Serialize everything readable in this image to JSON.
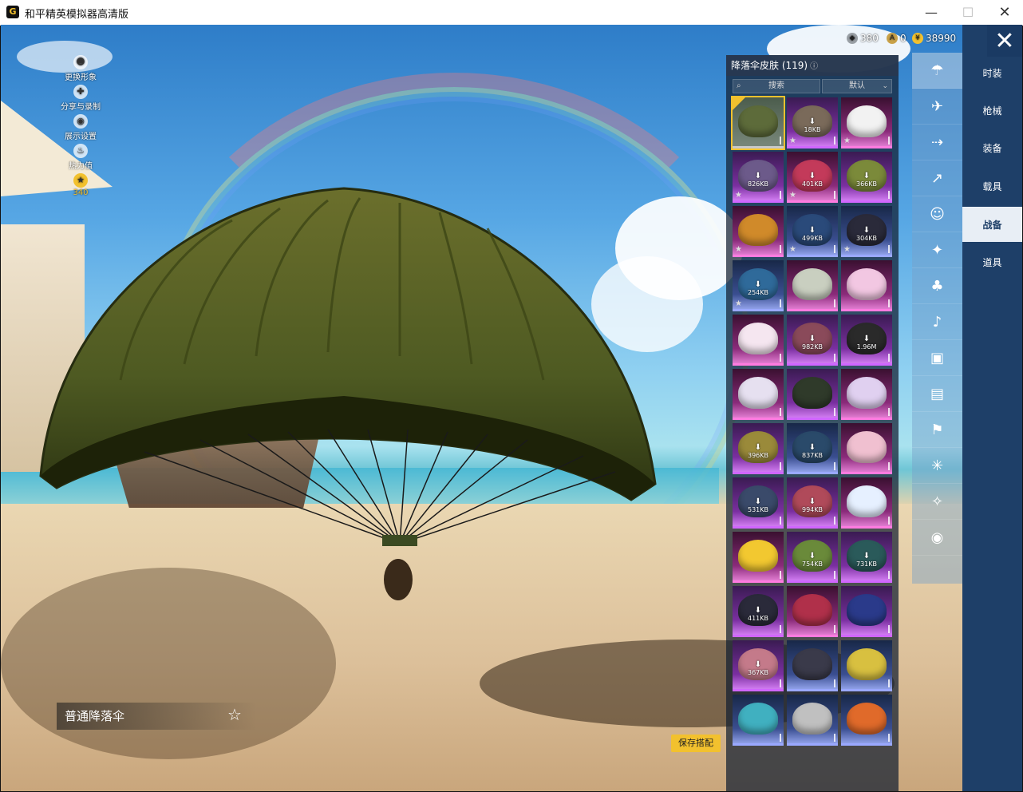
{
  "window": {
    "title": "和平精英模拟器高清版",
    "minimize": "—",
    "maximize": "☐",
    "close": "✕"
  },
  "currency": [
    {
      "icon": "gem-coin-icon",
      "value": "380",
      "color": "#9aa0a6"
    },
    {
      "icon": "badge-coin-icon",
      "value": "0",
      "color": "#c9a24a"
    },
    {
      "icon": "gold-coin-icon",
      "value": "38990",
      "color": "#f2c12e"
    }
  ],
  "left_menu": [
    {
      "icon": "avatar-icon",
      "label": "更换形象"
    },
    {
      "icon": "share-icon",
      "label": "分享与录制"
    },
    {
      "icon": "eye-icon",
      "label": "展示设置"
    },
    {
      "icon": "flame-icon",
      "label": "热力值"
    },
    {
      "icon": "level-badge-icon",
      "label": "340"
    }
  ],
  "skin_panel": {
    "title": "降落伞皮肤 (119)",
    "search_placeholder": "搜索",
    "sort_label": "默认",
    "tiles": [
      {
        "rarity": "gray",
        "color": "#5d6b3a",
        "size": "",
        "selected": true,
        "star": false
      },
      {
        "rarity": "purple",
        "color": "#7a6a5a",
        "size": "18KB",
        "star": true
      },
      {
        "rarity": "magenta",
        "color": "#f2f2f2",
        "size": "",
        "star": true
      },
      {
        "rarity": "purple",
        "color": "#6c5a8a",
        "size": "826KB",
        "star": true
      },
      {
        "rarity": "magenta",
        "color": "#c33a5a",
        "size": "401KB",
        "star": true
      },
      {
        "rarity": "purple",
        "color": "#7b8a3a",
        "size": "366KB",
        "star": false
      },
      {
        "rarity": "magenta",
        "color": "#d08a2a",
        "size": "",
        "star": true
      },
      {
        "rarity": "blue",
        "color": "#2a4a7a",
        "size": "499KB",
        "star": true
      },
      {
        "rarity": "blue",
        "color": "#2a2a3a",
        "size": "304KB",
        "star": true
      },
      {
        "rarity": "blue",
        "color": "#2f6a9a",
        "size": "254KB",
        "star": true
      },
      {
        "rarity": "magenta",
        "color": "#c9cfc0",
        "size": "",
        "star": false
      },
      {
        "rarity": "magenta",
        "color": "#f2c7e2",
        "size": "",
        "star": false
      },
      {
        "rarity": "magenta",
        "color": "#f5e6f0",
        "size": "",
        "star": false
      },
      {
        "rarity": "purple",
        "color": "#8a4a5a",
        "size": "982KB",
        "star": false
      },
      {
        "rarity": "purple",
        "color": "#2a2a2a",
        "size": "1.96M",
        "star": false
      },
      {
        "rarity": "magenta",
        "color": "#e6e0f0",
        "size": "",
        "star": false
      },
      {
        "rarity": "purple",
        "color": "#2f3a2a",
        "size": "",
        "star": false
      },
      {
        "rarity": "magenta",
        "color": "#e0d0f0",
        "size": "",
        "star": false
      },
      {
        "rarity": "purple",
        "color": "#9a8a3a",
        "size": "396KB",
        "star": false
      },
      {
        "rarity": "blue",
        "color": "#2a4a6a",
        "size": "837KB",
        "star": false
      },
      {
        "rarity": "magenta",
        "color": "#f0c0d0",
        "size": "",
        "star": false
      },
      {
        "rarity": "purple",
        "color": "#3a4a6a",
        "size": "531KB",
        "star": false
      },
      {
        "rarity": "purple",
        "color": "#b04a5a",
        "size": "994KB",
        "star": false
      },
      {
        "rarity": "magenta",
        "color": "#e6f0ff",
        "size": "",
        "star": false
      },
      {
        "rarity": "magenta",
        "color": "#f2c830",
        "size": "",
        "star": false
      },
      {
        "rarity": "purple",
        "color": "#6a8a3a",
        "size": "754KB",
        "star": false
      },
      {
        "rarity": "purple",
        "color": "#2a5a5a",
        "size": "731KB",
        "star": false
      },
      {
        "rarity": "purple",
        "color": "#2a2a3a",
        "size": "411KB",
        "star": false
      },
      {
        "rarity": "magenta",
        "color": "#b0304a",
        "size": "",
        "star": false
      },
      {
        "rarity": "purple",
        "color": "#2a3a8a",
        "size": "",
        "star": false
      },
      {
        "rarity": "purple",
        "color": "#c47a8a",
        "size": "367KB",
        "star": false
      },
      {
        "rarity": "blue",
        "color": "#3a3a4a",
        "size": "",
        "star": false
      },
      {
        "rarity": "blue",
        "color": "#d8c040",
        "size": "",
        "star": false
      },
      {
        "rarity": "blue",
        "color": "#40b0c0",
        "size": "",
        "star": false
      },
      {
        "rarity": "blue",
        "color": "#c0c0c0",
        "size": "",
        "star": false
      },
      {
        "rarity": "blue",
        "color": "#e06a2a",
        "size": "",
        "star": false
      }
    ]
  },
  "category_icons": [
    {
      "icon": "parachute-icon",
      "glyph": "☂",
      "active": true
    },
    {
      "icon": "plane-icon",
      "glyph": "✈"
    },
    {
      "icon": "aircraft-icon",
      "glyph": "⇢"
    },
    {
      "icon": "glider-icon",
      "glyph": "↗"
    },
    {
      "icon": "emote-icon",
      "glyph": "☺"
    },
    {
      "icon": "gun-icon",
      "glyph": "✦"
    },
    {
      "icon": "pendant-icon",
      "glyph": "♣"
    },
    {
      "icon": "sound-icon",
      "glyph": "♪"
    },
    {
      "icon": "badge-icon",
      "glyph": "▣"
    },
    {
      "icon": "photo-icon",
      "glyph": "▤"
    },
    {
      "icon": "extinguisher-icon",
      "glyph": "⚑"
    },
    {
      "icon": "firework-icon",
      "glyph": "✳"
    },
    {
      "icon": "wand-icon",
      "glyph": "✧"
    },
    {
      "icon": "ufo-icon",
      "glyph": "◉"
    }
  ],
  "nav_tabs": [
    {
      "label": "时装",
      "active": false
    },
    {
      "label": "枪械",
      "active": false
    },
    {
      "label": "装备",
      "active": false
    },
    {
      "label": "载具",
      "active": false
    },
    {
      "label": "战备",
      "active": true
    },
    {
      "label": "道具",
      "active": false
    }
  ],
  "item_name": "普通降落伞",
  "fav_star": "☆",
  "save_button": "保存搭配",
  "close_glyph": "✕"
}
